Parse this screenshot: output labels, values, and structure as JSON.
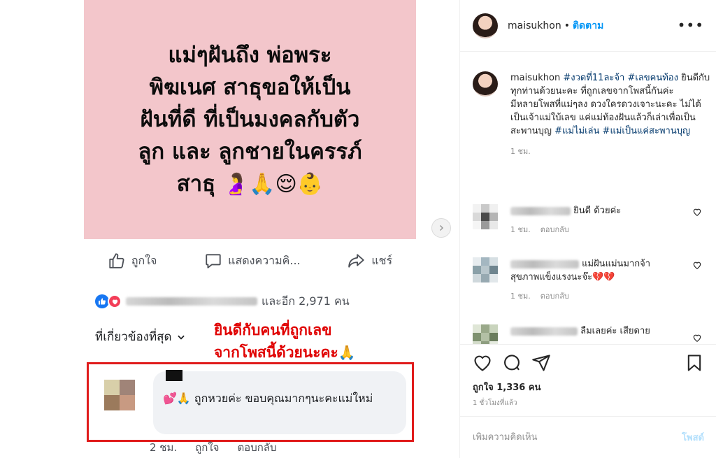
{
  "colors": {
    "instagram_blue": "#0095f6",
    "hashtag": "#00376b",
    "pink_post_bg": "#f3c6cb",
    "highlight_red": "#e01b1b",
    "fb_like_blue": "#1877f2",
    "fb_love_red": "#f33e58"
  },
  "media": {
    "post_text": "แม่ๆฝันถึง พ่อพระ\nพิฆเนศ สาธุขอให้เป็น\nฝันที่ดี ที่เป็นมงคลกับตัว\nลูก และ ลูกชายในครรภ์\nสาธุ",
    "post_emojis": "🤰🙏😌👶",
    "actions": {
      "like": "ถูกใจ",
      "comment": "แสดงความคิ...",
      "share": "แชร์"
    },
    "reactions_text": "และอีก 2,971 คน",
    "sort_label": "ที่เกี่ยวข้องที่สุด",
    "overlay_text": "ยินดีกับคนที่ถูกเลข\nจากโพสนี้ด้วยนะคะ",
    "overlay_emoji": "🙏",
    "highlighted_comment": {
      "text": "💕🙏 ถูกหวยค่ะ  ขอบคุณมากๆนะคะแม่ใหม่",
      "time": "2 ชม.",
      "like": "ถูกใจ",
      "reply": "ตอบกลับ"
    },
    "next_icon": "chevron-right"
  },
  "sidebar": {
    "header": {
      "username": "maisukhon",
      "dot": "•",
      "follow": "ติดตาม",
      "more": "•••"
    },
    "caption": {
      "username": "maisukhon",
      "tag1": "#งวดที่11ละจ้า",
      "tag2": "#เลขคนท้อง",
      "line1": "ยินดีกับทุกท่านด้วยนะคะ ที่ถูกเลขจากโพสนี้กันค่ะ",
      "line2": "มีหลายโพสที่แม่ๆลง ดวงใครดวงเจาะนะคะ ไม่ได้เป็นเจ้าแม่ใบ้เลข แค่แม่ท้องฝันแล้วก็เล่าเพื่อเป็นสะพานบุญ",
      "tag3": "#แม่ไม่เล่น",
      "tag4": "#แม่เป็นแค่สะพานบุญ",
      "time": "1 ชม."
    },
    "comments": [
      {
        "text": "ยินดี ด้วยค่ะ",
        "time": "1 ชม.",
        "reply": "ตอบกลับ"
      },
      {
        "text": "แม่ฝันแม่นมากจ้า สุขภาพแข็งแรงนะจ๊ะ💔💔",
        "time": "1 ชม.",
        "reply": "ตอบกลับ"
      },
      {
        "text": "ลืมเลยค่ะ เสียดาย",
        "time": "",
        "reply": ""
      }
    ],
    "likes": "ถูกใจ 1,336 คน",
    "time_ago": "1 ชั่วโมงที่แล้ว",
    "add_comment_placeholder": "เพิ่มความคิดเห็น",
    "post_button": "โพสต์"
  }
}
